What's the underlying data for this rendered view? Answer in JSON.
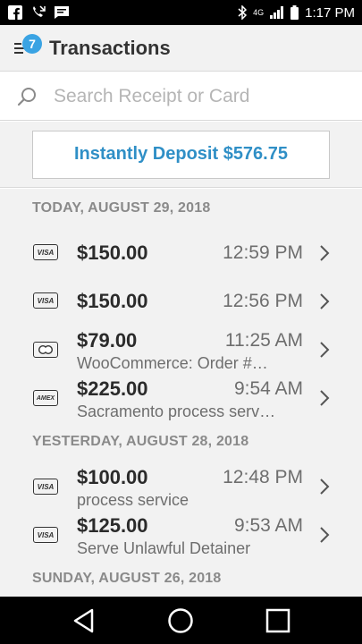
{
  "status_bar": {
    "time": "1:17 PM",
    "left_icons": [
      "facebook-icon",
      "missed-call-icon",
      "message-icon"
    ],
    "right_icons": [
      "bluetooth-icon",
      "lte-icon",
      "signal-icon",
      "battery-icon"
    ],
    "lte_label": "4G"
  },
  "header": {
    "badge_count": "7",
    "title": "Transactions"
  },
  "search": {
    "placeholder": "Search Receipt or Card"
  },
  "deposit": {
    "label": "Instantly Deposit $576.75"
  },
  "sections": [
    {
      "heading": "TODAY, AUGUST 29, 2018",
      "items": [
        {
          "card": "VISA",
          "amount": "$150.00",
          "time": "12:59 PM",
          "note": ""
        },
        {
          "card": "VISA",
          "amount": "$150.00",
          "time": "12:56 PM",
          "note": ""
        },
        {
          "card": "MASTERCARD",
          "amount": "$79.00",
          "time": "11:25 AM",
          "note": "WooCommerce: Order #…"
        },
        {
          "card": "AMEX",
          "amount": "$225.00",
          "time": "9:54 AM",
          "note": "Sacramento process serv…"
        }
      ]
    },
    {
      "heading": "YESTERDAY, AUGUST 28, 2018",
      "items": [
        {
          "card": "VISA",
          "amount": "$100.00",
          "time": "12:48 PM",
          "note": "process service"
        },
        {
          "card": "VISA",
          "amount": "$125.00",
          "time": "9:53 AM",
          "note": "Serve Unlawful Detainer"
        }
      ]
    },
    {
      "heading": "SUNDAY, AUGUST 26, 2018",
      "items": []
    }
  ],
  "nav": {
    "buttons": [
      "back-icon",
      "home-icon",
      "recents-icon"
    ]
  },
  "colors": {
    "accent": "#3aa3e3",
    "deposit_text": "#2f8fc6",
    "section_bg": "#f2f2f2"
  }
}
